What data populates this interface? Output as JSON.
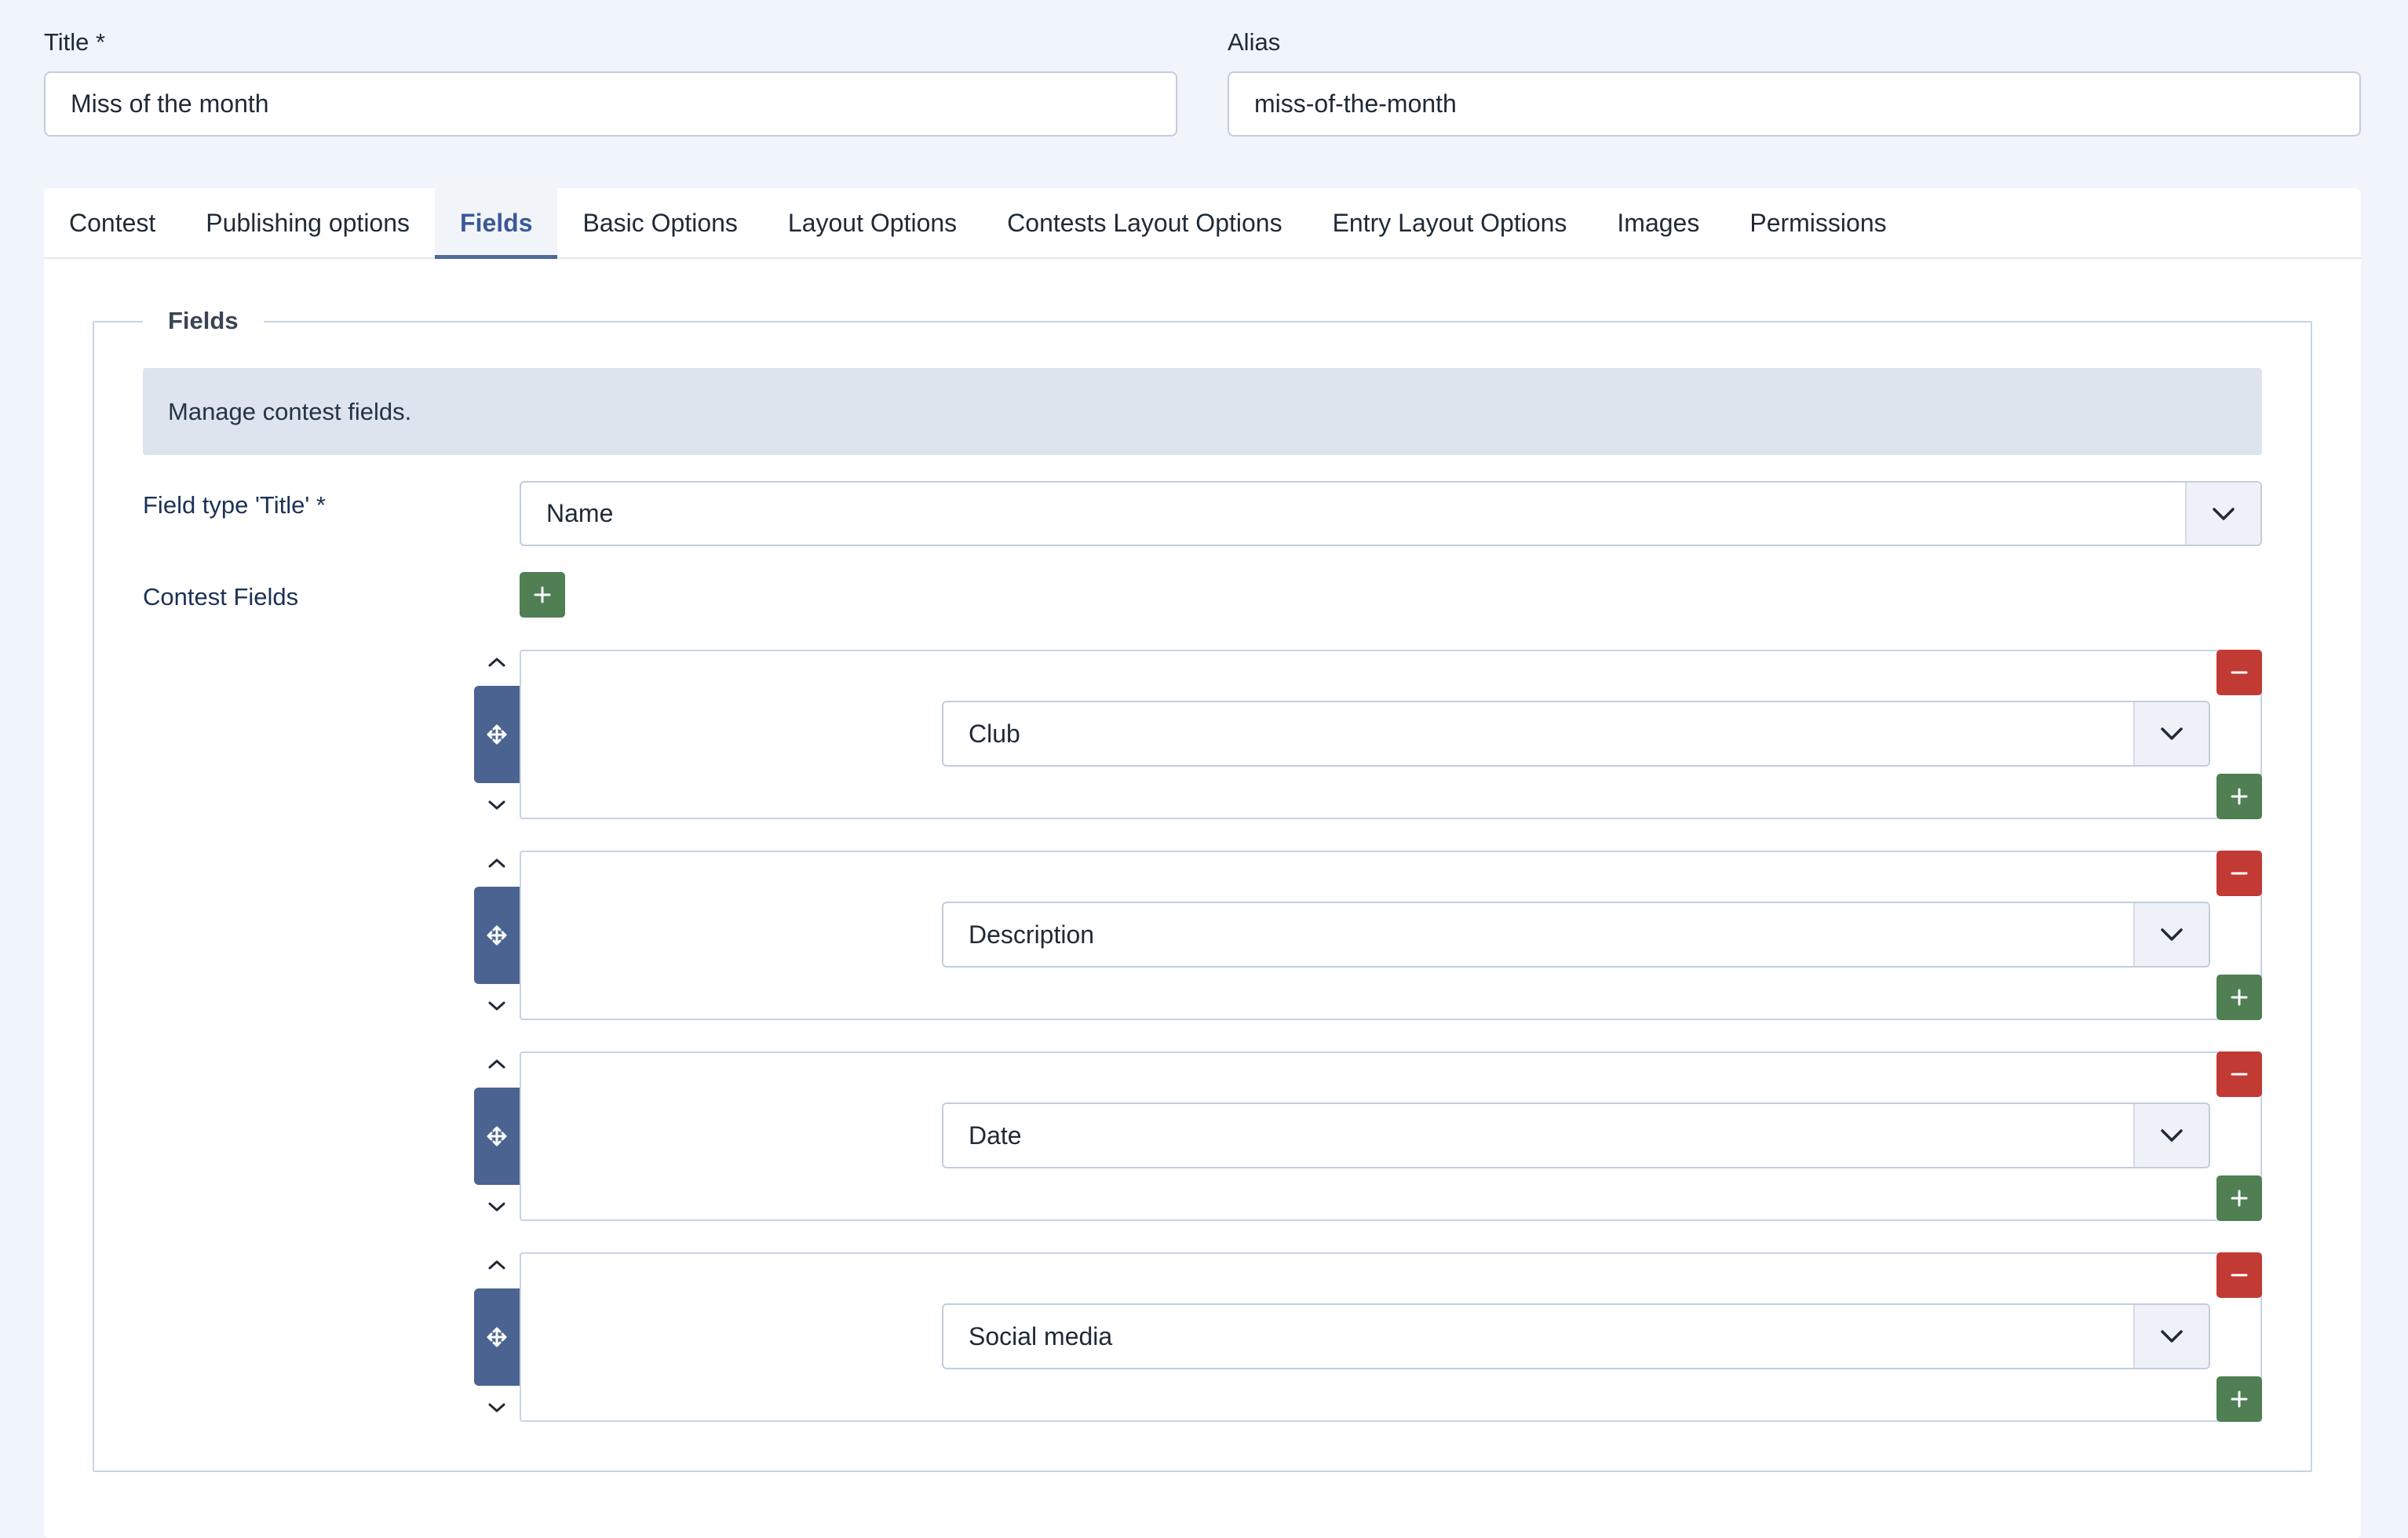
{
  "title_field": {
    "label": "Title *",
    "value": "Miss of the month"
  },
  "alias_field": {
    "label": "Alias",
    "value": "miss-of-the-month"
  },
  "tabs": [
    {
      "label": "Contest"
    },
    {
      "label": "Publishing options"
    },
    {
      "label": "Fields",
      "active": true
    },
    {
      "label": "Basic Options"
    },
    {
      "label": "Layout Options"
    },
    {
      "label": "Contests Layout Options"
    },
    {
      "label": "Entry Layout Options"
    },
    {
      "label": "Images"
    },
    {
      "label": "Permissions"
    }
  ],
  "fieldset": {
    "legend": "Fields",
    "info": "Manage contest fields.",
    "field_type_title": {
      "label": "Field type 'Title' *",
      "selected": "Name"
    },
    "contest_fields": {
      "label": "Contest Fields",
      "rows": [
        {
          "selected": "Club"
        },
        {
          "selected": "Description"
        },
        {
          "selected": "Date"
        },
        {
          "selected": "Social media"
        }
      ]
    }
  },
  "colors": {
    "accent": "#4c6b9a",
    "add_green": "#4f7f53",
    "remove_red": "#c23a34",
    "drag_blue": "#4a6391",
    "page_bg": "#f0f4fb",
    "info_bg": "#dee4ee"
  },
  "icons": {
    "add": "plus-icon",
    "remove": "minus-icon",
    "drag": "move-icon",
    "up": "chevron-up-icon",
    "down": "chevron-down-icon",
    "select": "chevron-down-icon"
  }
}
